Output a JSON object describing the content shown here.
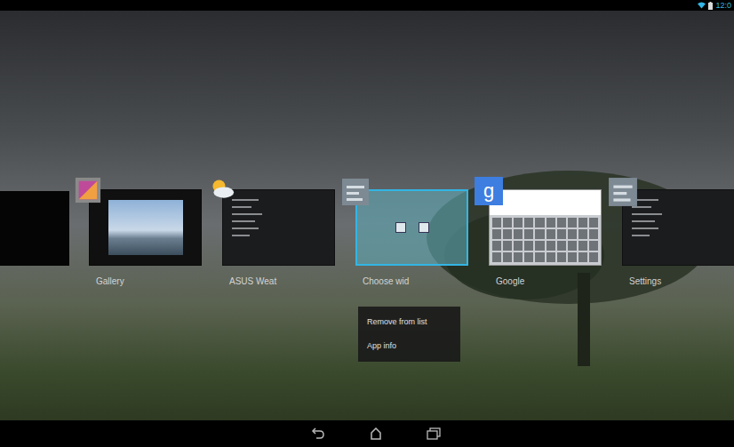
{
  "status_bar": {
    "time": "12:0"
  },
  "recent_apps": [
    {
      "label": "Gallery",
      "selected": false,
      "kind": "photo"
    },
    {
      "label": "ASUS Weat",
      "selected": false,
      "kind": "list"
    },
    {
      "label": "Choose wid",
      "selected": true,
      "kind": "widget"
    },
    {
      "label": "Google",
      "selected": false,
      "kind": "keyboard",
      "icon_text": "g"
    },
    {
      "label": "Settings",
      "selected": false,
      "kind": "list"
    }
  ],
  "context_menu": {
    "items": [
      "Remove from list",
      "App info"
    ]
  }
}
